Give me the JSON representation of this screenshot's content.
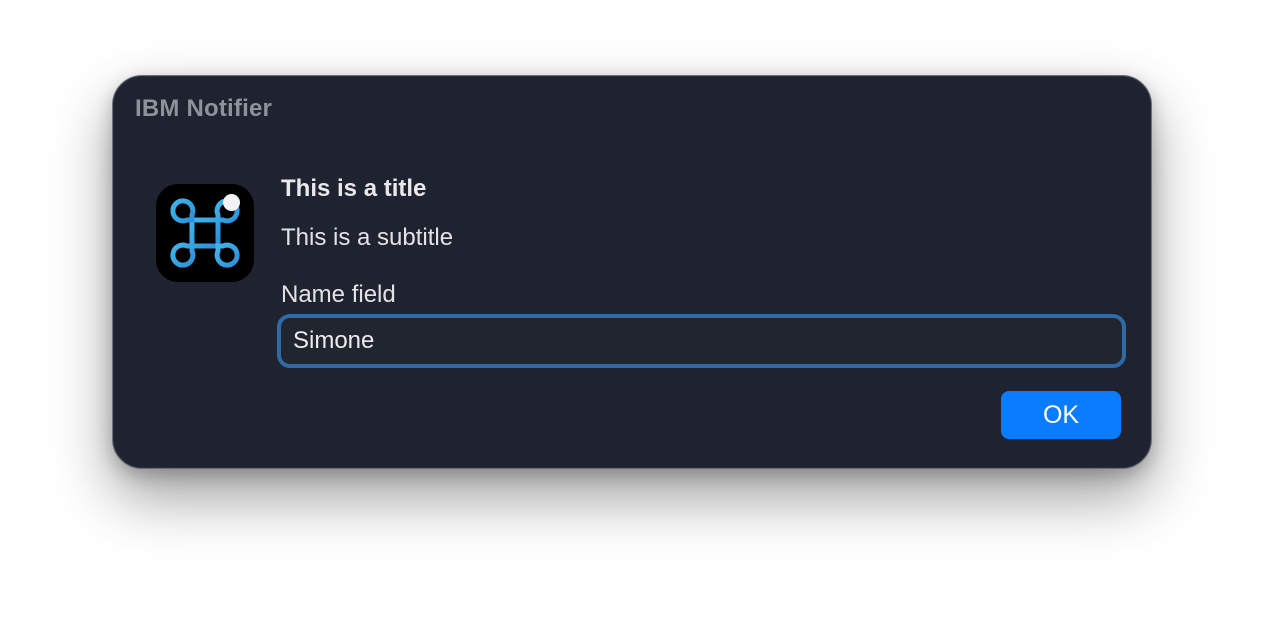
{
  "window": {
    "title": "IBM Notifier"
  },
  "app_icon": {
    "icon": "command-key-icon",
    "badge": "notification-dot",
    "colors": {
      "background": "#000000",
      "glyph": "#3fb6ea",
      "dot": "#f2f2f2"
    }
  },
  "message": {
    "title": "This is a title",
    "subtitle": "This is a subtitle"
  },
  "form": {
    "field_label": "Name field",
    "field_value": "Simone"
  },
  "buttons": {
    "ok_label": "OK"
  },
  "colors": {
    "window_background": "#1f2330",
    "accent": "#0a7cff",
    "focus_ring": "#2f6aa4"
  }
}
